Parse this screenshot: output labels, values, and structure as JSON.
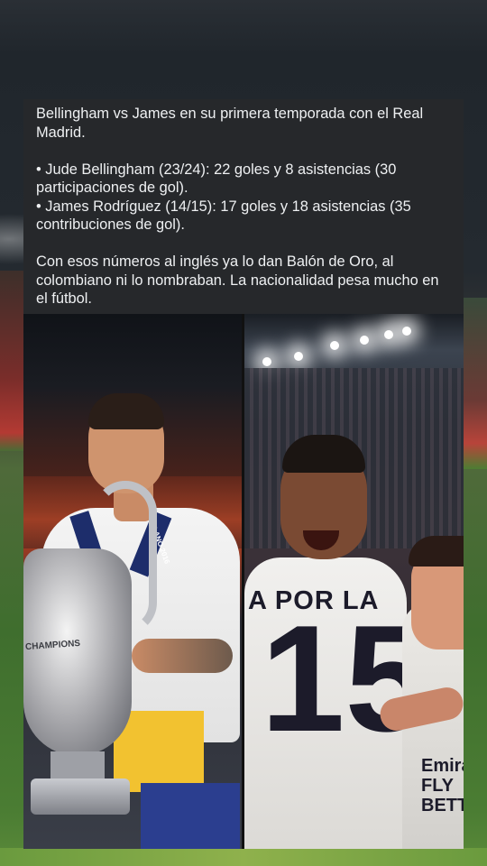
{
  "post": {
    "title": "Bellingham vs James en su primera temporada con el Real Madrid.",
    "bullets": [
      "• Jude Bellingham (23/24): 22 goles y 8 asistencias (30 participaciones de gol).",
      "• James Rodríguez (14/15): 17 goles y 18 asistencias (35 contribuciones de gol)."
    ],
    "conclusion": "Con esos números al inglés ya lo dan Balón de Oro, al colombiano ni lo nombraban. La nacionalidad pesa mucho en el fútbol."
  },
  "photos": {
    "left": {
      "trophy_text": "CHAMPIONS",
      "lanyard_text": "MILANO 2016"
    },
    "right": {
      "jersey_text": "A POR LA",
      "jersey_number": "15",
      "sponsor_text": "Emirates FLY BETTER"
    }
  }
}
